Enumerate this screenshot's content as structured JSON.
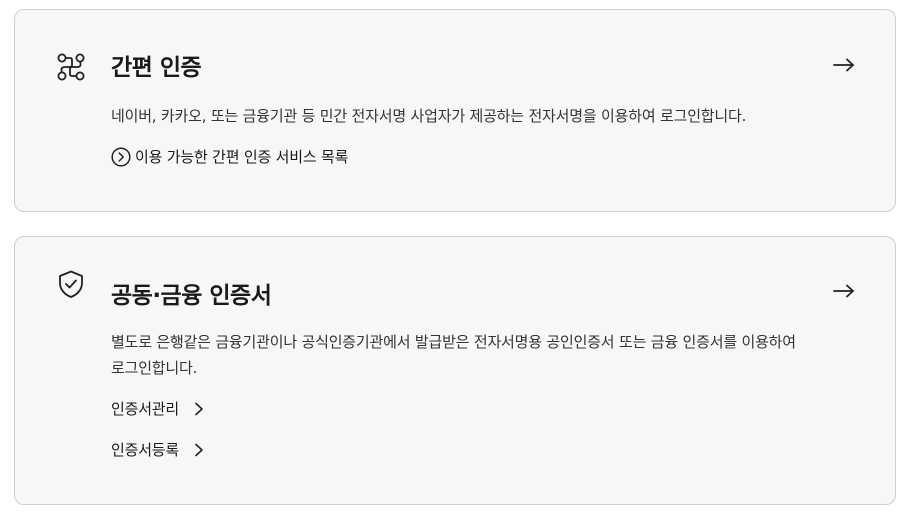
{
  "simple_auth": {
    "title": "간편 인증",
    "description": "네이버, 카카오, 또는 금융기관 등 민간 전자서명 사업자가 제공하는 전자서명을 이용하여 로그인합니다.",
    "service_list_link": "이용 가능한 간편 인증 서비스 목록",
    "icon": "route-nodes-icon",
    "arrow_icon": "arrow-right-icon"
  },
  "certificate_auth": {
    "title": "공동·금융 인증서",
    "description": "별도로 은행같은 금융기관이나 공식인증기관에서 발급받은 전자서명용 공인인증서 또는 금융 인증서를 이용하여 로그인합니다.",
    "links": [
      {
        "label": "인증서관리"
      },
      {
        "label": "인증서등록"
      }
    ],
    "icon": "shield-check-icon",
    "arrow_icon": "arrow-right-icon"
  },
  "colors": {
    "card_background": "#f7f7f7",
    "card_border": "#cfcfcf",
    "text": "#1a1a1a"
  }
}
